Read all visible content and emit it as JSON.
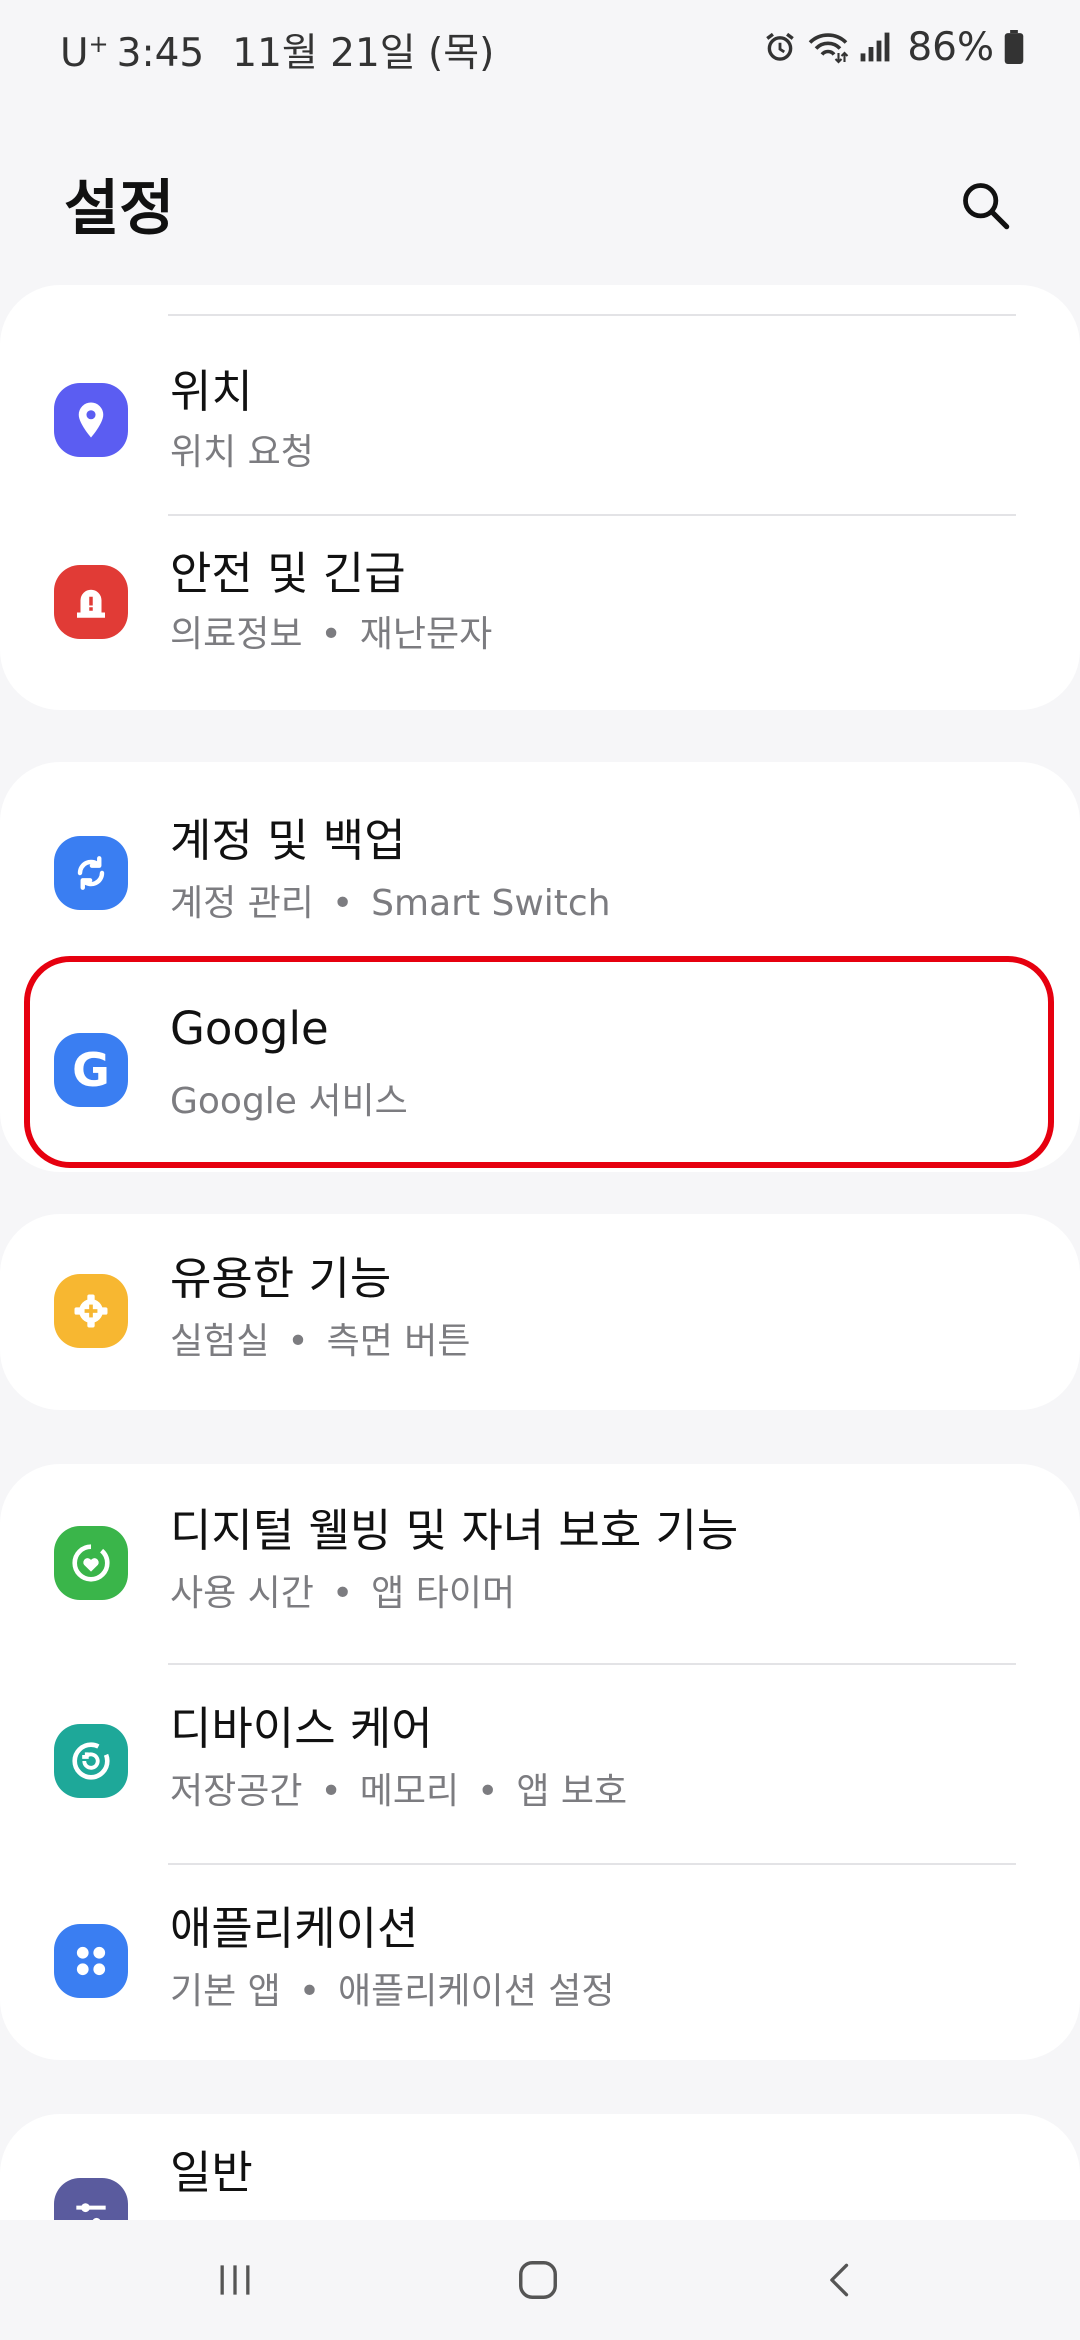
{
  "status_bar": {
    "carrier": "U",
    "carrier_sup": "+",
    "time": "3:45",
    "date": "11월 21일 (목)",
    "battery": "86%"
  },
  "header": {
    "title": "설정"
  },
  "items": {
    "location": {
      "title": "위치",
      "subtitle": "위치 요청",
      "icon": "location-pin-icon",
      "color": "#5b5df2"
    },
    "safety": {
      "title": "안전 및 긴급",
      "sub1": "의료정보",
      "sub2": "재난문자",
      "icon": "siren-icon",
      "color": "#e13b36"
    },
    "accounts": {
      "title": "계정 및 백업",
      "sub1": "계정 관리",
      "sub2": "Smart Switch",
      "icon": "sync-icon",
      "color": "#3a7ef2"
    },
    "google": {
      "title": "Google",
      "subtitle": "Google 서비스",
      "icon": "google-g-icon",
      "color": "#3a7ef2"
    },
    "advanced": {
      "title": "유용한 기능",
      "sub1": "실험실",
      "sub2": "측면 버튼",
      "icon": "puzzle-gear-icon",
      "color": "#f7b731"
    },
    "wellbeing": {
      "title": "디지털 웰빙 및 자녀 보호 기능",
      "sub1": "사용 시간",
      "sub2": "앱 타이머",
      "icon": "heart-circle-icon",
      "color": "#3ab54a"
    },
    "device_care": {
      "title": "디바이스 케어",
      "sub1": "저장공간",
      "sub2": "메모리",
      "sub3": "앱 보호",
      "icon": "refresh-circle-icon",
      "color": "#1ea899"
    },
    "apps": {
      "title": "애플리케이션",
      "sub1": "기본 앱",
      "sub2": "애플리케이션 설정",
      "icon": "apps-grid-icon",
      "color": "#3a7ef2"
    },
    "general": {
      "title": "일반",
      "icon": "sliders-icon",
      "color": "#5a5b9e"
    }
  },
  "separator": "•",
  "colors": {
    "highlight": "#e6000f",
    "background": "#f6f6f8"
  }
}
